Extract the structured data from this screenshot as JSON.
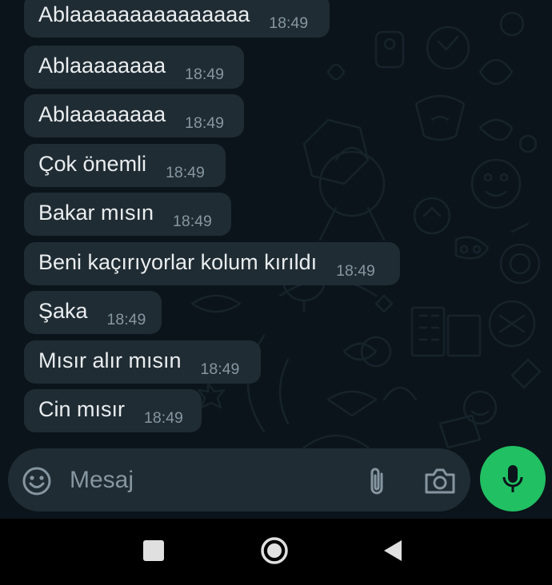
{
  "messages": [
    {
      "text": "Ablaaaaaaaaaaaaaaa",
      "time": "18:49"
    },
    {
      "text": "Ablaaaaaaaa",
      "time": "18:49"
    },
    {
      "text": "Ablaaaaaaaa",
      "time": "18:49"
    },
    {
      "text": "Çok önemli",
      "time": "18:49"
    },
    {
      "text": "Bakar mısın",
      "time": "18:49"
    },
    {
      "text": "Beni kaçırıyorlar kolum kırıldı",
      "time": "18:49"
    },
    {
      "text": "Şaka",
      "time": "18:49"
    },
    {
      "text": "Mısır alır mısın",
      "time": "18:49"
    },
    {
      "text": "Cin mısır",
      "time": "18:49"
    }
  ],
  "composer": {
    "placeholder": "Mesaj",
    "emoji_icon": "emoji-icon",
    "attach_icon": "paperclip-icon",
    "camera_icon": "camera-icon",
    "mic_icon": "microphone-icon"
  },
  "navbar": {
    "recent_icon": "recent-apps-icon",
    "home_icon": "home-icon",
    "back_icon": "back-icon"
  },
  "colors": {
    "background": "#0b141a",
    "bubble": "#202c33",
    "text": "#e9edef",
    "timestamp": "#8696a0",
    "accent": "#21c063"
  }
}
